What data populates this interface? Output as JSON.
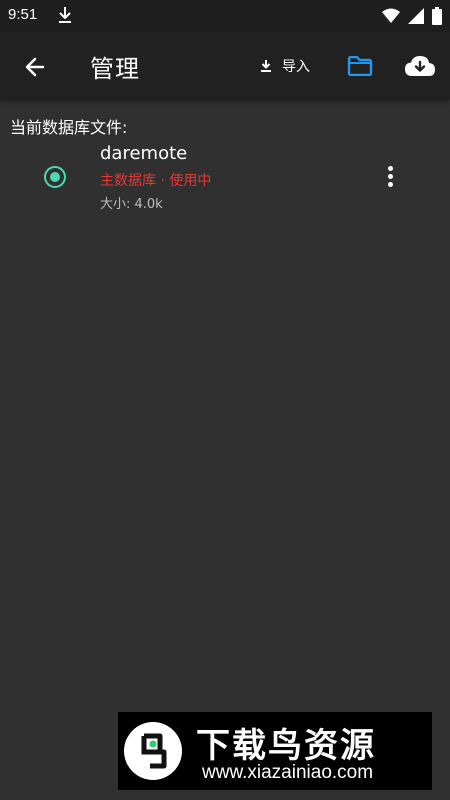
{
  "status_bar": {
    "time": "9:51",
    "icons": [
      "download-icon",
      "wifi-icon",
      "signal-icon",
      "battery-icon"
    ]
  },
  "app_bar": {
    "title": "管理",
    "back_icon": "arrow-left-icon",
    "import_label": "导入",
    "import_icon": "download-icon",
    "folder_icon": "folder-icon",
    "cloud_icon": "cloud-download-icon"
  },
  "content": {
    "section_label": "当前数据库文件:",
    "databases": [
      {
        "name": "daremote",
        "status": "主数据库 · 使用中",
        "size": "大小: 4.0k",
        "selected": true
      }
    ]
  },
  "watermark": {
    "title": "下载鸟资源",
    "url": "www.xiazainiao.com"
  },
  "colors": {
    "background": "#303030",
    "app_bar": "#212121",
    "status_bar": "#1f1f1f",
    "accent": "#4dd9b3",
    "folder_blue": "#2196f3",
    "status_red": "#e53935"
  }
}
